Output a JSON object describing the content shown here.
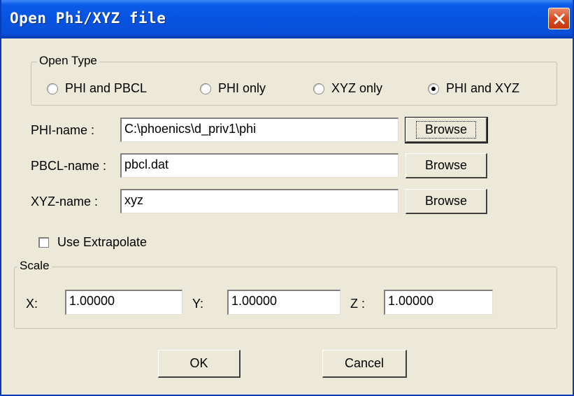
{
  "window": {
    "title": "Open Phi/XYZ file"
  },
  "open_type": {
    "legend": "Open Type",
    "options": [
      {
        "label": "PHI and PBCL",
        "checked": false
      },
      {
        "label": "PHI only",
        "checked": false
      },
      {
        "label": "XYZ only",
        "checked": false
      },
      {
        "label": "PHI and XYZ",
        "checked": true
      }
    ]
  },
  "files": {
    "phi_label": "PHI-name :",
    "phi_value": "C:\\phoenics\\d_priv1\\phi",
    "pbcl_label": "PBCL-name :",
    "pbcl_value": "pbcl.dat",
    "xyz_label": "XYZ-name :",
    "xyz_value": "xyz",
    "browse_label": "Browse"
  },
  "extrapolate": {
    "label": "Use Extrapolate",
    "checked": false
  },
  "scale": {
    "legend": "Scale",
    "x_label": "X:",
    "x_value": "1.00000",
    "y_label": "Y:",
    "y_value": "1.00000",
    "z_label": "Z :",
    "z_value": "1.00000"
  },
  "actions": {
    "ok_label": "OK",
    "cancel_label": "Cancel"
  }
}
